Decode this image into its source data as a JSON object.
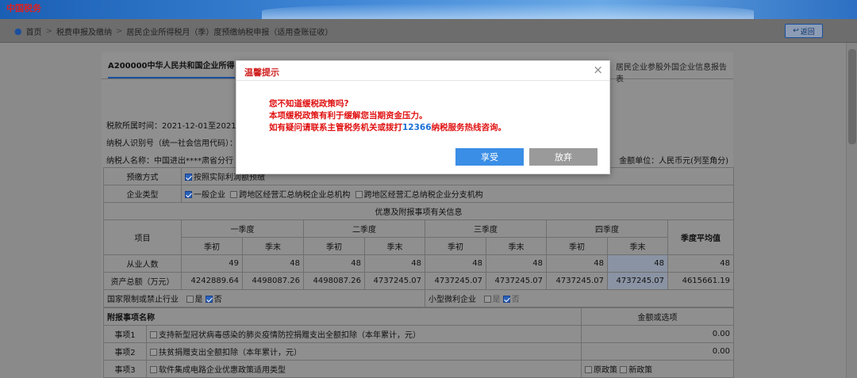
{
  "banner": {
    "logo": "中国税务"
  },
  "breadcrumb": {
    "home": "首页",
    "level2": "税费申报及缴纳",
    "level3": "居民企业所得税月（季）度预缴纳税申报（适用查账征收）",
    "separator": ">"
  },
  "back_button": {
    "label": "返回"
  },
  "tabs": {
    "active": "A200000中华人民共和国企业所得",
    "right": "居民企业参股外国企业信息报告表"
  },
  "info": {
    "period": "税款所属时间：2021-12-01至2021-12",
    "taxpayer_id": "纳税人识别号（统一社会信用代码）：",
    "taxpayer_name": "纳税人名称：中国进出****肃省分行",
    "unit": "金额单位：人民币元(列至角分)"
  },
  "form": {
    "prepay_method_label": "预缴方式",
    "prepay_method_option1": "按照实际利润额预缴",
    "enterprise_type_label": "企业类型",
    "enterprise_types": [
      "一般企业",
      "跨地区经营汇总纳税企业总机构",
      "跨地区经营汇总纳税企业分支机构"
    ],
    "section_title": "优惠及附报事项有关信息",
    "item_col": "项目",
    "quarters": [
      "一季度",
      "二季度",
      "三季度",
      "四季度"
    ],
    "q_start": "季初",
    "q_end": "季末",
    "avg_label": "季度平均值",
    "employees_label": "从业人数",
    "employees": [
      "49",
      "48",
      "48",
      "48",
      "48",
      "48",
      "48",
      "48"
    ],
    "employees_avg": "48",
    "assets_label": "资产总额（万元）",
    "assets": [
      "4242889.64",
      "4498087.26",
      "4498087.26",
      "4737245.07",
      "4737245.07",
      "4737245.07",
      "4737245.07",
      "4737245.07"
    ],
    "assets_avg": "4615661.19",
    "restricted_label": "国家限制或禁止行业",
    "small_label": "小型微利企业",
    "yes": "是",
    "no": "否",
    "attach_header": "附报事项名称",
    "amount_header": "金额或选项",
    "matters": [
      {
        "label": "事项1",
        "name": "支持新型冠状病毒感染的肺炎疫情防控捐赠支出全额扣除（本年累计，元）",
        "value": "0.00"
      },
      {
        "label": "事项2",
        "name": "扶贫捐赠支出全额扣除（本年累计，元）",
        "value": "0.00"
      },
      {
        "label": "事项3",
        "name": "软件集成电路企业优惠政策适用类型",
        "opt1": "原政策",
        "opt2": "新政策"
      }
    ]
  },
  "modal": {
    "title": "温馨提示",
    "line1": "您不知道缓税政策吗?",
    "line2": "本项缓税政策有利于缓解您当期资金压力。",
    "line3_pre": "如有疑问请联系主管税务机关或拨打",
    "hotline": "12366",
    "line3_post": "纳税服务热线咨询。",
    "accept": "享受",
    "decline": "放弃"
  }
}
